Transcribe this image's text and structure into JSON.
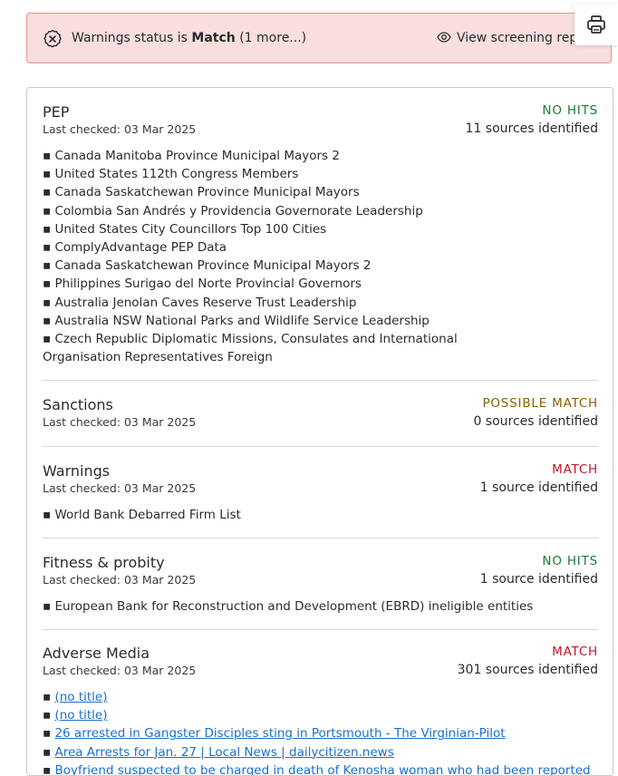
{
  "banner": {
    "prefix": "Warnings status is",
    "status": "Match",
    "more": "(1 more...)",
    "view_report": "View screening rep",
    "color_bg": "#f9dede",
    "color_border": "#ef8f8f"
  },
  "icons": {
    "banner": "circle-x-icon",
    "view": "eye-icon",
    "print": "printer-icon"
  },
  "sections": [
    {
      "title": "PEP",
      "checked": "Last checked: 03 Mar 2025",
      "status": "NO HITS",
      "status_color": "#1e7a3c",
      "sources": "11 sources identified",
      "items": [
        "Canada Manitoba Province Municipal Mayors 2",
        "United States 112th Congress Members",
        "Canada Saskatchewan Province Municipal Mayors",
        "Colombia San Andrés y Providencia Governorate Leadership",
        "United States City Councillors Top 100 Cities",
        "ComplyAdvantage PEP Data",
        "Canada Saskatchewan Province Municipal Mayors 2",
        "Philippines Surigao del Norte Provincial Governors",
        "Australia Jenolan Caves Reserve Trust Leadership",
        "Australia NSW National Parks and Wildlife Service Leadership",
        "Czech Republic Diplomatic Missions, Consulates and International Organisation Representatives Foreign"
      ]
    },
    {
      "title": "Sanctions",
      "checked": "Last checked: 03 Mar 2025",
      "status": "POSSIBLE MATCH",
      "status_color": "#8a6000",
      "sources": "0 sources identified",
      "items": []
    },
    {
      "title": "Warnings",
      "checked": "Last checked: 03 Mar 2025",
      "status": "MATCH",
      "status_color": "#c0162a",
      "sources": "1 source identified",
      "items": [
        "World Bank Debarred Firm List"
      ]
    },
    {
      "title": "Fitness & probity",
      "checked": "Last checked: 03 Mar 2025",
      "status": "NO HITS",
      "status_color": "#1e7a3c",
      "sources": "1 source identified",
      "items": [
        "European Bank for Reconstruction and Development (EBRD) ineligible entities"
      ]
    },
    {
      "title": "Adverse Media",
      "checked": "Last checked: 03 Mar 2025",
      "status": "MATCH",
      "status_color": "#c0162a",
      "sources": "301 sources identified",
      "links": [
        "(no title)",
        "(no title)",
        "26 arrested in Gangster Disciples sting in Portsmouth - The Virginian-Pilot",
        "Area Arrests for Jan. 27 | Local News | dailycitizen.news",
        "Boyfriend suspected to be charged in death of Kenosha woman who had been reported"
      ]
    }
  ]
}
